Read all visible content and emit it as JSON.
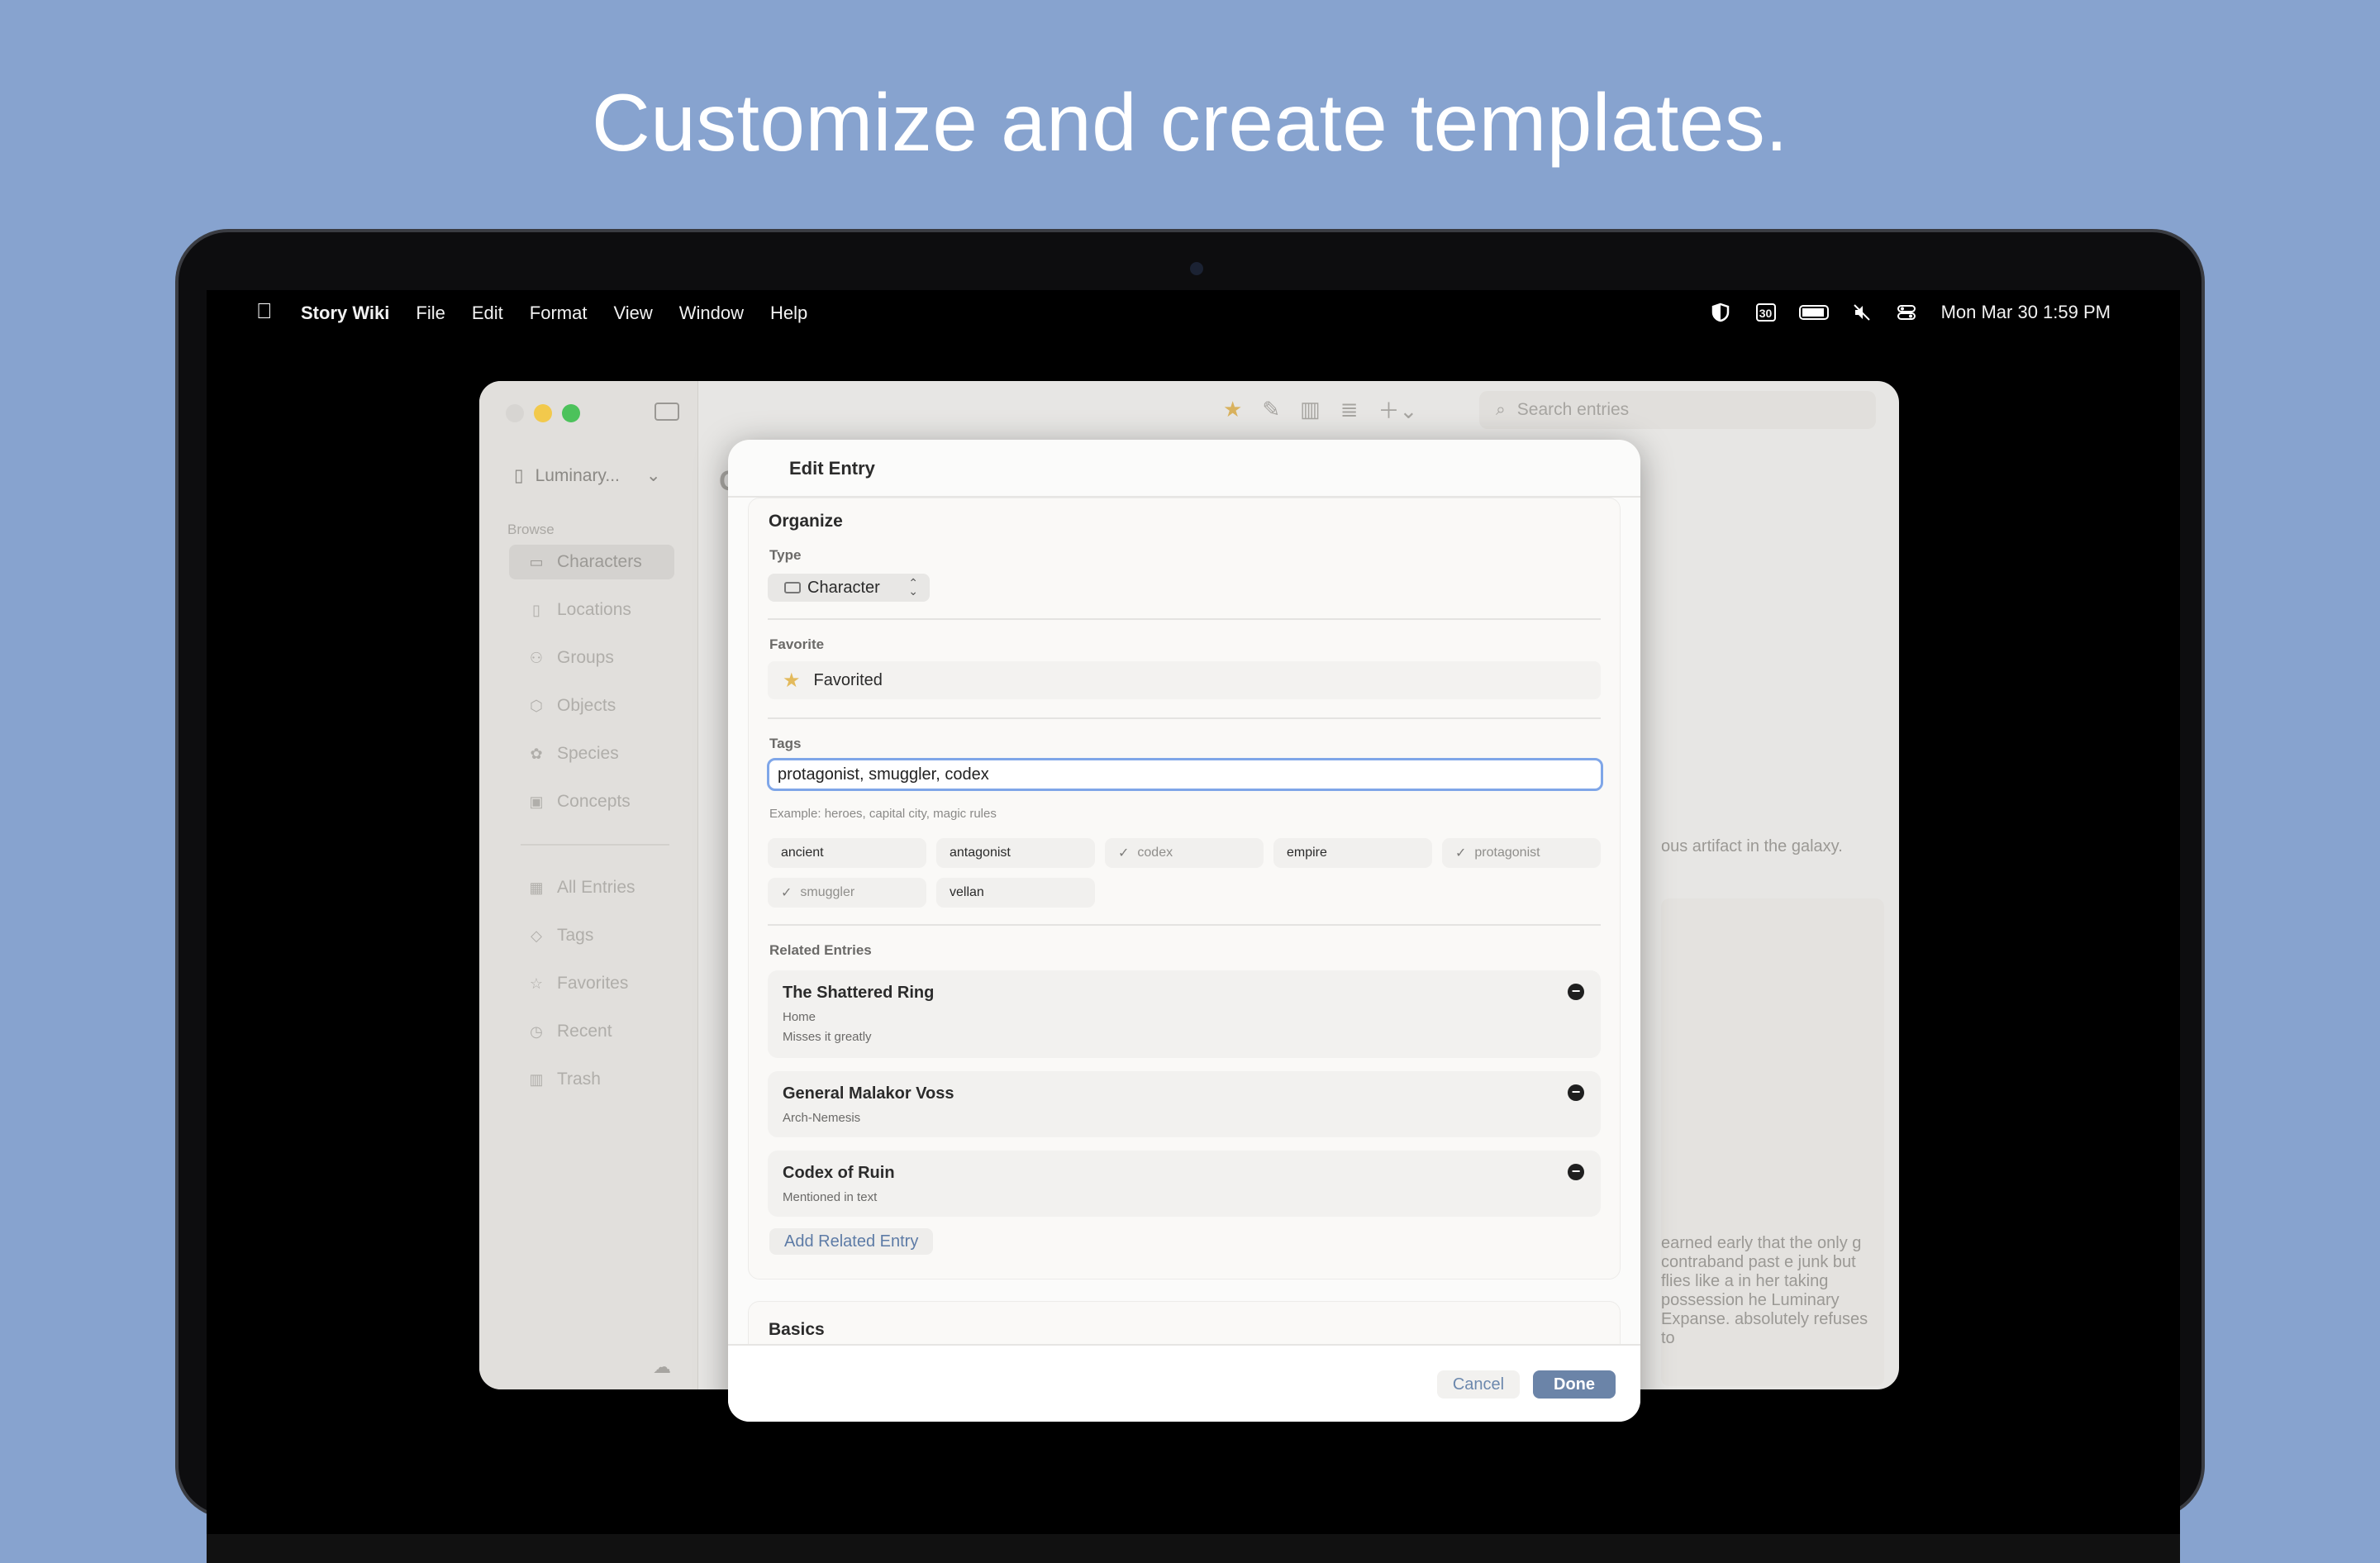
{
  "headline": "Customize and create templates.",
  "menubar": {
    "app_name": "Story Wiki",
    "menus": [
      "File",
      "Edit",
      "Format",
      "View",
      "Window",
      "Help"
    ],
    "calendar_day": "30",
    "clock": "Mon Mar 30  1:59 PM"
  },
  "sidebar": {
    "project": "Luminary...",
    "browse_label": "Browse",
    "items": [
      {
        "label": "Characters",
        "icon": "person-card-icon",
        "glyph": "▭",
        "active": true
      },
      {
        "label": "Locations",
        "icon": "map-icon",
        "glyph": "▯"
      },
      {
        "label": "Groups",
        "icon": "people-icon",
        "glyph": "⚇"
      },
      {
        "label": "Objects",
        "icon": "cube-icon",
        "glyph": "⬡"
      },
      {
        "label": "Species",
        "icon": "paw-icon",
        "glyph": "✿"
      },
      {
        "label": "Concepts",
        "icon": "lightbulb-icon",
        "glyph": "▣"
      }
    ],
    "items2": [
      {
        "label": "All Entries",
        "icon": "grid-icon",
        "glyph": "▦"
      },
      {
        "label": "Tags",
        "icon": "tag-icon",
        "glyph": "◇"
      },
      {
        "label": "Favorites",
        "icon": "star-icon",
        "glyph": "☆"
      },
      {
        "label": "Recent",
        "icon": "clock-icon",
        "glyph": "◷"
      },
      {
        "label": "Trash",
        "icon": "trash-icon",
        "glyph": "▥"
      }
    ]
  },
  "toolbar": {
    "search_placeholder": "Search entries"
  },
  "background": {
    "peek_letter": "C",
    "desc_snippet": "ous artifact in the galaxy.",
    "para_snippet": "earned early that the only g contraband past e junk but flies like a in her taking possession he Luminary Expanse. absolutely refuses to"
  },
  "modal": {
    "title": "Edit Entry",
    "organize": {
      "heading": "Organize",
      "type_label": "Type",
      "type_value": "Character",
      "favorite_label": "Favorite",
      "favorite_value": "Favorited",
      "tags_label": "Tags",
      "tags_value": "protagonist, smuggler, codex",
      "tags_help": "Example: heroes, capital city, magic rules",
      "tag_chips": [
        {
          "label": "ancient",
          "selected": false
        },
        {
          "label": "antagonist",
          "selected": false
        },
        {
          "label": "codex",
          "selected": true
        },
        {
          "label": "empire",
          "selected": false
        },
        {
          "label": "protagonist",
          "selected": true
        },
        {
          "label": "smuggler",
          "selected": true
        },
        {
          "label": "vellan",
          "selected": false
        }
      ],
      "related_label": "Related Entries",
      "related": [
        {
          "name": "The Shattered Ring",
          "relation": "Home",
          "note": "Misses it greatly"
        },
        {
          "name": "General Malakor Voss",
          "relation": "Arch-Nemesis",
          "note": ""
        },
        {
          "name": "Codex of Ruin",
          "relation": "Mentioned in text",
          "note": ""
        }
      ],
      "add_related": "Add Related Entry"
    },
    "basics_heading": "Basics",
    "cancel": "Cancel",
    "done": "Done"
  },
  "colors": {
    "background": "#87a3cf",
    "accent": "#6b84a8",
    "focus_ring": "#7fa6e8",
    "star": "#e3ba5c"
  }
}
